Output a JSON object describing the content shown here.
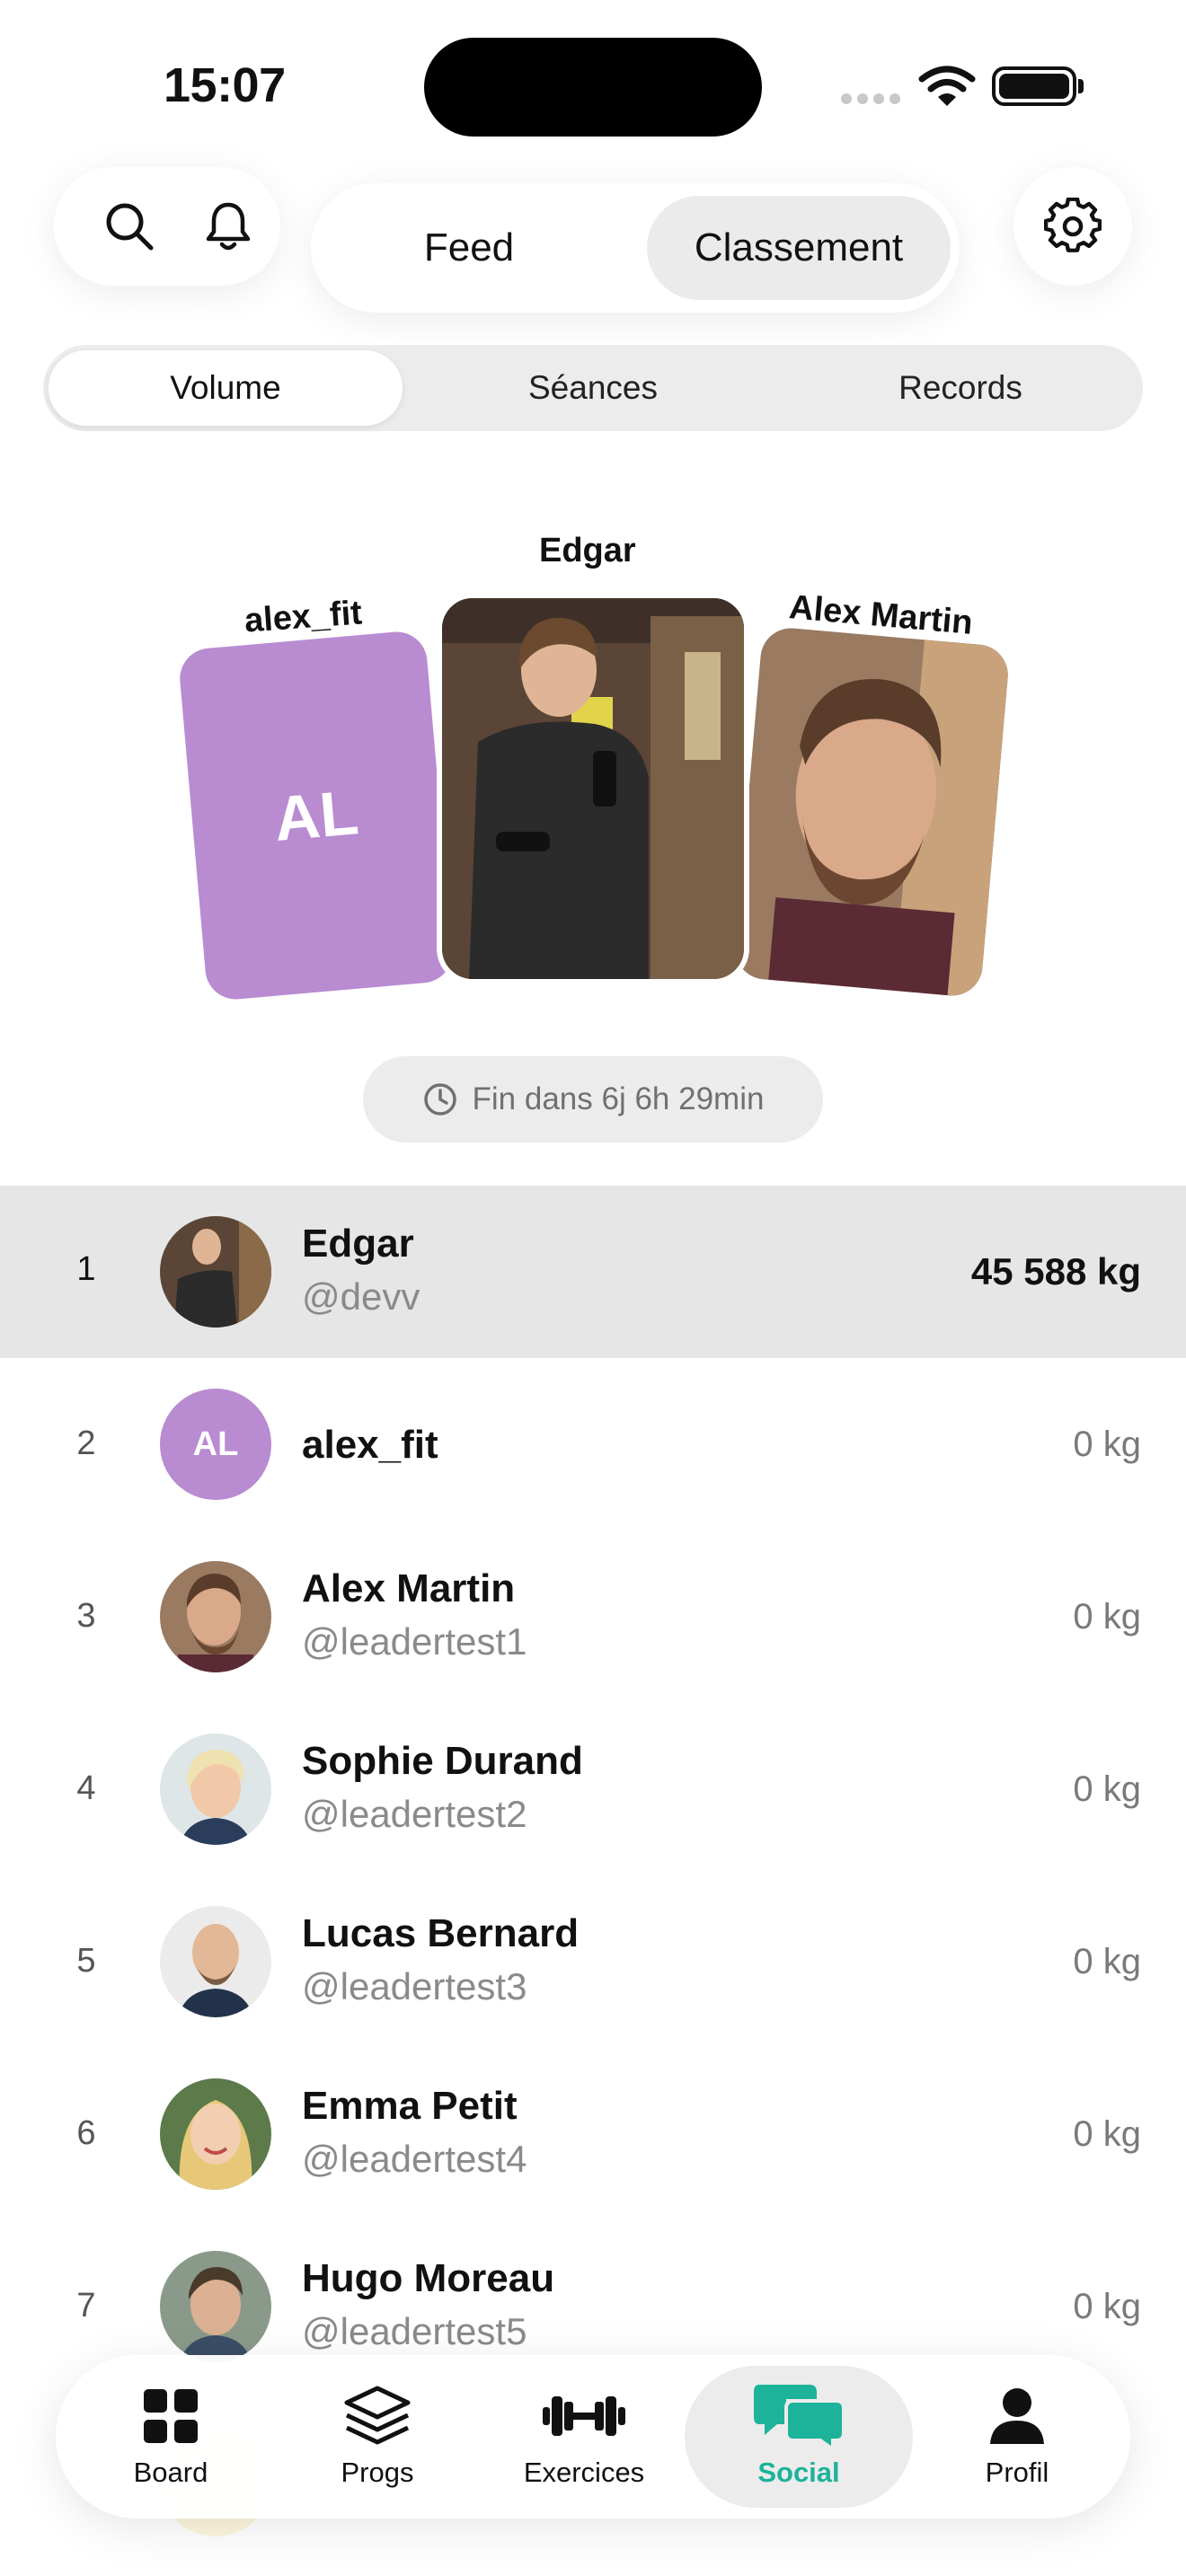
{
  "status_bar": {
    "time": "15:07"
  },
  "header": {
    "segments": [
      {
        "label": "Feed",
        "active": false
      },
      {
        "label": "Classement",
        "active": true
      }
    ]
  },
  "tabs": [
    {
      "label": "Volume",
      "active": true
    },
    {
      "label": "Séances",
      "active": false
    },
    {
      "label": "Records",
      "active": false
    }
  ],
  "podium": {
    "first": {
      "name": "Edgar"
    },
    "second": {
      "name": "alex_fit",
      "initials": "AL"
    },
    "third": {
      "name": "Alex Martin"
    }
  },
  "timer": {
    "text": "Fin dans 6j 6h 29min"
  },
  "leaderboard": [
    {
      "rank": "1",
      "name": "Edgar",
      "handle": "@devv",
      "score": "45 588 kg"
    },
    {
      "rank": "2",
      "name": "alex_fit",
      "handle": "",
      "initials": "AL",
      "score": "0 kg"
    },
    {
      "rank": "3",
      "name": "Alex Martin",
      "handle": "@leadertest1",
      "score": "0 kg"
    },
    {
      "rank": "4",
      "name": "Sophie Durand",
      "handle": "@leadertest2",
      "score": "0 kg"
    },
    {
      "rank": "5",
      "name": "Lucas Bernard",
      "handle": "@leadertest3",
      "score": "0 kg"
    },
    {
      "rank": "6",
      "name": "Emma Petit",
      "handle": "@leadertest4",
      "score": "0 kg"
    },
    {
      "rank": "7",
      "name": "Hugo Moreau",
      "handle": "@leadertest5",
      "score": "0 kg"
    }
  ],
  "bottom_nav": [
    {
      "label": "Board",
      "icon": "grid-icon",
      "active": false
    },
    {
      "label": "Progs",
      "icon": "layers-icon",
      "active": false
    },
    {
      "label": "Exercices",
      "icon": "dumbbell-icon",
      "active": false
    },
    {
      "label": "Social",
      "icon": "chat-bubbles-icon",
      "active": true
    },
    {
      "label": "Profil",
      "icon": "person-icon",
      "active": false
    }
  ],
  "colors": {
    "accent": "#1db39a",
    "avatar_purple": "#b98bd1",
    "highlight_row": "#e6e6e6"
  }
}
